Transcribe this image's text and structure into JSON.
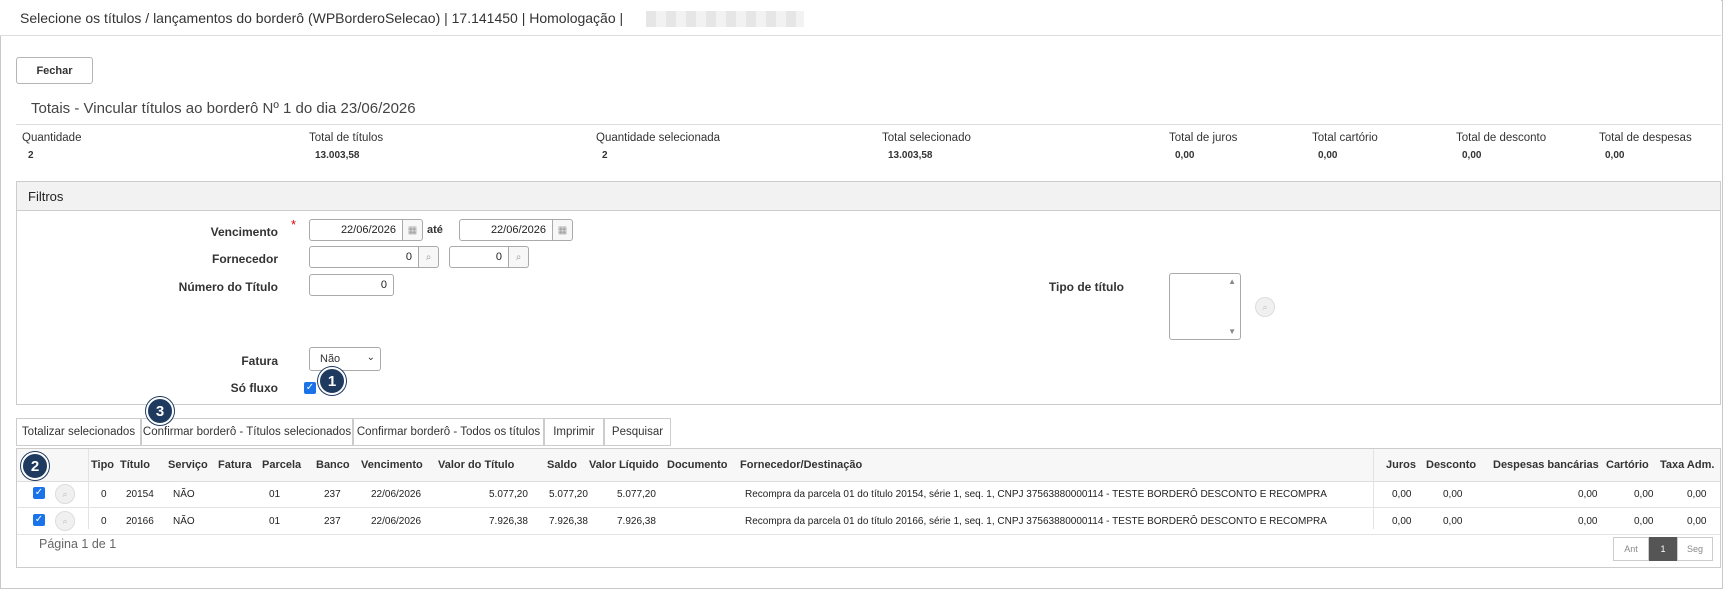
{
  "window": {
    "title": "Selecione os títulos / lançamentos do borderô (WPBorderoSelecao) | 17.141450 | Homologação |"
  },
  "actions": {
    "close_label": "Fechar"
  },
  "totals": {
    "title": "Totais - Vincular títulos ao borderô Nº 1 do dia 23/06/2026",
    "items": [
      {
        "label": "Quantidade",
        "value": "2"
      },
      {
        "label": "Total de títulos",
        "value": "13.003,58"
      },
      {
        "label": "Quantidade selecionada",
        "value": "2"
      },
      {
        "label": "Total selecionado",
        "value": "13.003,58"
      },
      {
        "label": "Total de juros",
        "value": "0,00"
      },
      {
        "label": "Total cartório",
        "value": "0,00"
      },
      {
        "label": "Total de desconto",
        "value": "0,00"
      },
      {
        "label": "Total de despesas",
        "value": "0,00"
      }
    ]
  },
  "filters": {
    "title": "Filtros",
    "vencimento": {
      "label": "Vencimento",
      "required_mark": "*",
      "from": "22/06/2026",
      "sep": "até",
      "to": "22/06/2026"
    },
    "fornecedor": {
      "label": "Fornecedor",
      "from": "0",
      "to": "0"
    },
    "numero_titulo": {
      "label": "Número do Título",
      "value": "0"
    },
    "tipo_titulo": {
      "label": "Tipo de título"
    },
    "fatura": {
      "label": "Fatura",
      "value": "Não"
    },
    "so_fluxo": {
      "label": "Só fluxo",
      "checked": true
    }
  },
  "markers": [
    "1",
    "2",
    "3"
  ],
  "toolbar": [
    "Totalizar selecionados",
    "Confirmar borderô - Títulos selecionados",
    "Confirmar borderô - Todos os títulos",
    "Imprimir",
    "Pesquisar"
  ],
  "grid": {
    "columns": [
      "Tipo",
      "Título",
      "Serviço",
      "Fatura",
      "Parcela",
      "Banco",
      "Vencimento",
      "Valor do Título",
      "Saldo",
      "Valor Líquido",
      "Documento",
      "Fornecedor/Destinação",
      "Juros",
      "Desconto",
      "Despesas bancárias",
      "Cartório",
      "Taxa Adm."
    ],
    "rows": [
      {
        "tipo": "0",
        "titulo": "20154",
        "servico": "NÃO",
        "fatura": "",
        "parcela": "01",
        "banco": "237",
        "vencimento": "22/06/2026",
        "valor": "5.077,20",
        "saldo": "5.077,20",
        "liquido": "5.077,20",
        "documento": "",
        "fornecedor": "Recompra da parcela 01 do título 20154, série 1, seq. 1, CNPJ 37563880000114 - TESTE BORDERÔ DESCONTO E RECOMPRA",
        "juros": "0,00",
        "desconto": "0,00",
        "despesas": "0,00",
        "cartorio": "0,00",
        "taxa": "0,00"
      },
      {
        "tipo": "0",
        "titulo": "20166",
        "servico": "NÃO",
        "fatura": "",
        "parcela": "01",
        "banco": "237",
        "vencimento": "22/06/2026",
        "valor": "7.926,38",
        "saldo": "7.926,38",
        "liquido": "7.926,38",
        "documento": "",
        "fornecedor": "Recompra da parcela 01 do título 20166, série 1, seq. 1, CNPJ 37563880000114 - TESTE BORDERÔ DESCONTO E RECOMPRA",
        "juros": "0,00",
        "desconto": "0,00",
        "despesas": "0,00",
        "cartorio": "0,00",
        "taxa": "0,00"
      }
    ],
    "pager": {
      "text": "Página 1 de 1",
      "prev": "Ant",
      "page": "1",
      "next": "Seg"
    }
  }
}
